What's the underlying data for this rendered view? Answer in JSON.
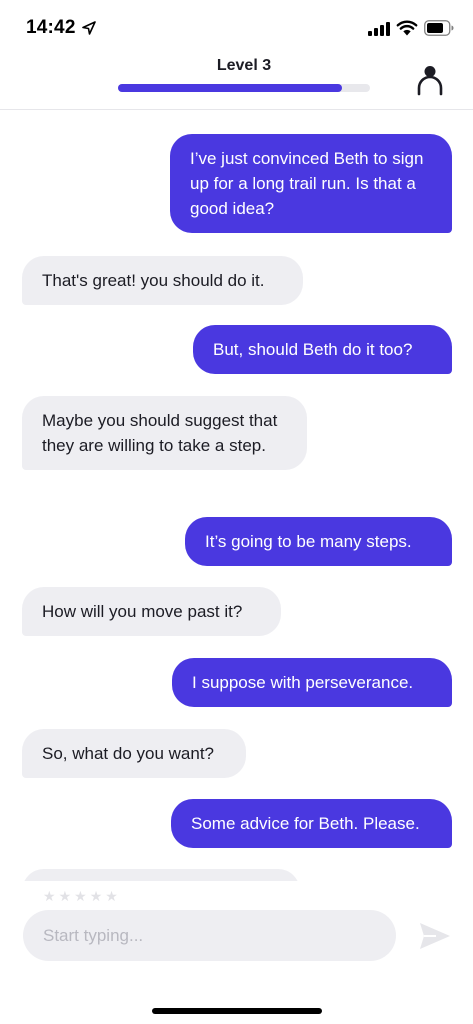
{
  "status_bar": {
    "time": "14:42",
    "icons": [
      "location-arrow-icon",
      "cellular-signal-icon",
      "wifi-icon",
      "battery-icon"
    ]
  },
  "header": {
    "title": "Level 3",
    "progress": 0.89,
    "profile_icon": "person-icon"
  },
  "colors": {
    "accent": "#4a38e0",
    "bot_bubble": "#eeeef2",
    "text": "#1c1c24"
  },
  "messages": [
    {
      "role": "user",
      "text": "I’ve just convinced Beth to sign up for a long trail run. Is that a good idea?"
    },
    {
      "role": "bot",
      "text": "That's great! you should do it."
    },
    {
      "role": "user",
      "text": "But, should Beth do it too?"
    },
    {
      "role": "bot",
      "text": "Maybe you should suggest that they are willing to take a step."
    },
    {
      "role": "user",
      "text": "It’s going to be many steps."
    },
    {
      "role": "bot",
      "text": "How will you move past it?"
    },
    {
      "role": "user",
      "text": "I suppose with perseverance."
    },
    {
      "role": "bot",
      "text": "So, what do you want?"
    },
    {
      "role": "user",
      "text": "Some advice for Beth. Please."
    }
  ],
  "rating": {
    "stars": 5,
    "value": 0
  },
  "input": {
    "placeholder": "Start typing...",
    "value": "",
    "send_icon": "send-icon"
  }
}
